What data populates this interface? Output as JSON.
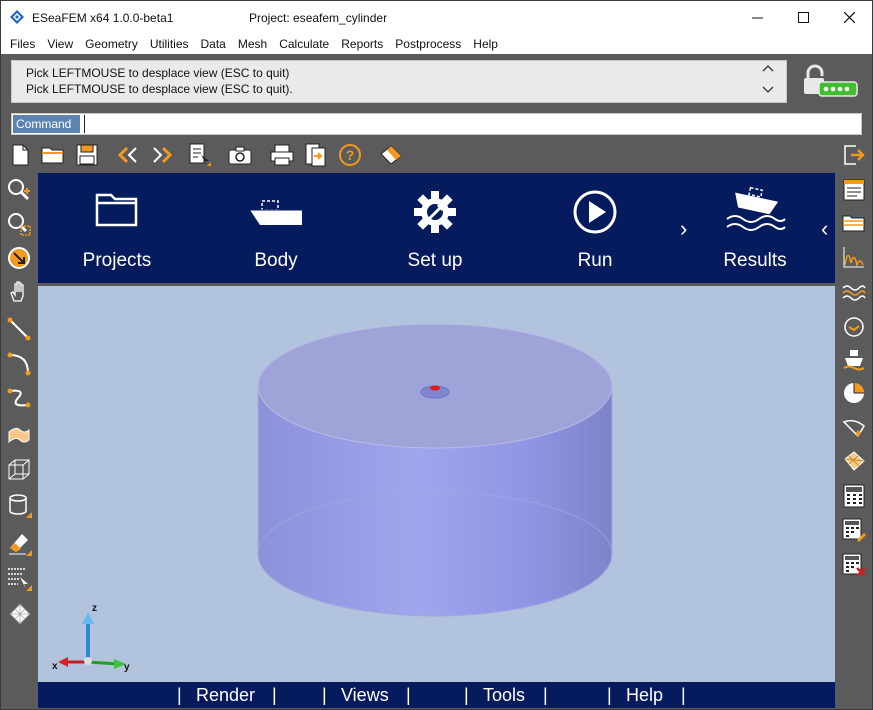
{
  "title_bar": {
    "app_title": "ESeaFEM x64 1.0.0-beta1",
    "project_title": "Project: eseafem_cylinder",
    "minimize_icon": "minimize-icon",
    "maximize_icon": "maximize-icon",
    "close_icon": "close-icon"
  },
  "menu": [
    "Files",
    "View",
    "Geometry",
    "Utilities",
    "Data",
    "Mesh",
    "Calculate",
    "Reports",
    "Postprocess",
    "Help"
  ],
  "messages": {
    "line1": "Pick LEFTMOUSE to desplace view (ESC to quit)",
    "line2": "Pick LEFTMOUSE to desplace view (ESC to quit)."
  },
  "command": {
    "label": "Command",
    "value": ""
  },
  "toolbar": {
    "icons": [
      "new-file-icon",
      "open-folder-icon",
      "save-icon",
      "undo-icon",
      "redo-icon",
      "pick-list-icon",
      "screenshot-icon",
      "print-icon",
      "export-icon",
      "help-icon",
      "render-eraser-icon"
    ],
    "exit_icon": "exit-icon"
  },
  "left_tools": [
    "zoom-in-icon",
    "zoom-frame-icon",
    "rotate-icon",
    "pan-hand-icon",
    "line-icon",
    "arc-icon",
    "polyline-icon",
    "surface-icon",
    "volume-icon",
    "cylinder-icon",
    "eraser-icon",
    "list-select-icon",
    "mesh-grid-icon"
  ],
  "right_tools": [
    "document-list-icon",
    "folders-icon",
    "spectrum-icon",
    "waves-icon",
    "rotation-icon",
    "mooring-icon",
    "pie-chart-icon",
    "hull-icon",
    "mesh-tag-icon",
    "calculator-icon",
    "calculator-edit-icon",
    "calculator-delete-icon"
  ],
  "nav": {
    "items": [
      {
        "label": "Projects",
        "icon": "folder-icon"
      },
      {
        "label": "Body",
        "icon": "ship-icon"
      },
      {
        "label": "Set up",
        "icon": "gear-icon"
      },
      {
        "label": "Run",
        "icon": "play-icon"
      },
      {
        "label": "Results",
        "icon": "ship-waves-icon"
      }
    ],
    "chevron_right": "›",
    "chevron_left": "‹"
  },
  "axes": {
    "z": "z",
    "x": "x",
    "y": "y"
  },
  "bottom": {
    "separator": "|",
    "items": [
      "Render",
      "Views",
      "Tools",
      "Help"
    ]
  },
  "colors": {
    "navy": "#051b5e",
    "viewport": "#b2c4dd",
    "cylinder": "#8f95dc",
    "accent_orange": "#f39a1e"
  }
}
